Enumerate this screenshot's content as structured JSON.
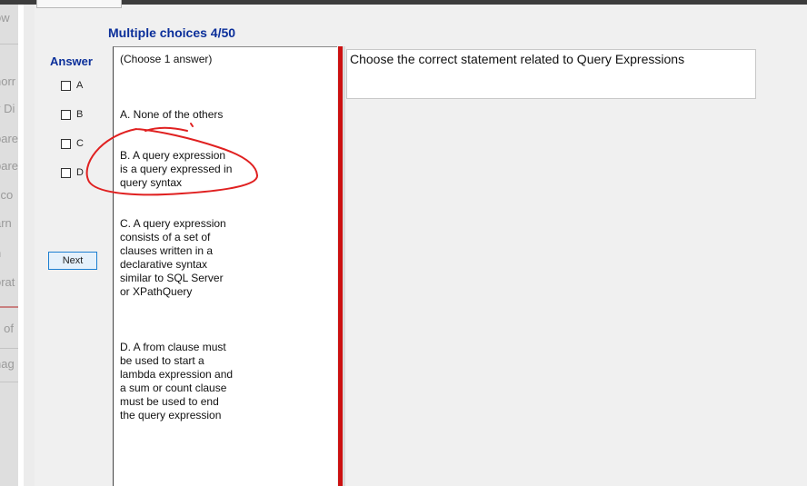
{
  "quiz": {
    "title": "Multiple choices 4/50",
    "note": "(Choose 1 answer)"
  },
  "answer_panel": {
    "label": "Answer",
    "options": [
      "A",
      "B",
      "C",
      "D"
    ]
  },
  "next_button": {
    "label": "Next"
  },
  "question": {
    "text": "Choose the correct statement related to Query Expressions"
  },
  "answers": {
    "a": "A.  None of the others",
    "b": "B.  A query expression is a query expressed in query syntax",
    "c": "C.  A query expression consists of a set of clauses written in a declarative syntax similar to SQL Server or XPathQuery",
    "d": "D.  A from clause must be used to start a lambda expression and a sum or count clause must be used to end the query expression"
  },
  "background_fragments": [
    "ow",
    "norr",
    "y Di",
    "pare",
    "pare",
    "sco",
    "arn",
    "n",
    "orat",
    "s of",
    "nag"
  ],
  "colors": {
    "title": "#0b2f9a",
    "divider": "#cc1111",
    "annotation": "#e02020"
  }
}
